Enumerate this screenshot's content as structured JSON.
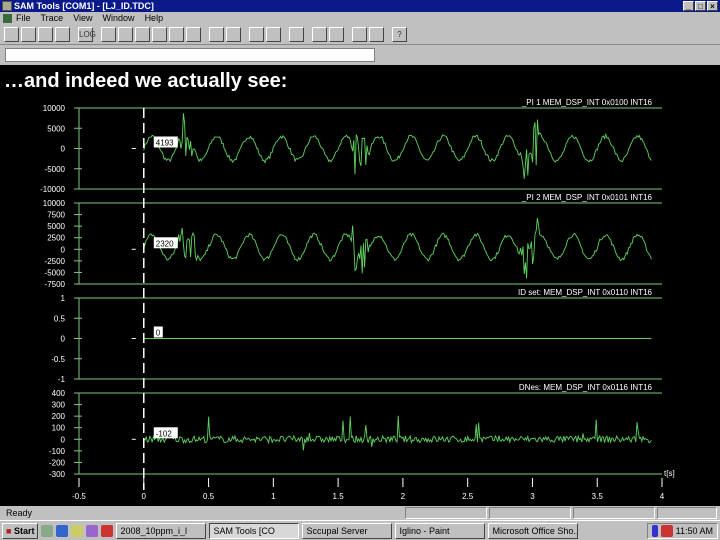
{
  "window": {
    "title": "SAM Tools [COM1] - [LJ_ID.TDC]",
    "controls": [
      "_",
      "□",
      "×"
    ]
  },
  "menu": [
    "File",
    "Trace",
    "View",
    "Window",
    "Help"
  ],
  "toolbar": {
    "icons": [
      "new-icon",
      "open-icon",
      "save-icon",
      "print-icon",
      "log-icon",
      "load-icon",
      "step-icon",
      "step2-icon",
      "run-icon",
      "stop-icon",
      "zoom-x-icon",
      "zoom-y-icon",
      "fit-icon",
      "grid-icon",
      "window-icon",
      "zoom-in-icon",
      "zoom-out-icon",
      "cascade-icon",
      "tile-h-icon",
      "tile-v-icon",
      "help-icon"
    ],
    "log_label": "LOG",
    "help_label": "?"
  },
  "command_input": {
    "value": ""
  },
  "heading": "…and indeed we actually see:",
  "chart_data": {
    "type": "line",
    "xlabel": "t[s]",
    "xlim": [
      -0.5,
      4
    ],
    "x_ticks": [
      "-0.5",
      "0",
      "0.5",
      "1",
      "1.5",
      "2",
      "2.5",
      "3",
      "3.5",
      "4"
    ],
    "cursor_x": 0,
    "panels": [
      {
        "title": "_PI 1 MEM_DSP_INT 0x0100 INT16",
        "ylim": [
          -10000,
          10000
        ],
        "y_ticks": [
          "10000",
          "5000",
          "0",
          "-5000",
          "-10000"
        ],
        "cursor_value": "4193"
      },
      {
        "title": "_PI 2 MEM_DSP_INT 0x0101 INT16",
        "ylim": [
          -7500,
          10000
        ],
        "y_ticks": [
          "10000",
          "7500",
          "5000",
          "2500",
          "0",
          "-2500",
          "-5000",
          "-7500"
        ],
        "cursor_value": "2320"
      },
      {
        "title": "ID set: MEM_DSP_INT 0x0110 INT16",
        "ylim": [
          -1,
          1
        ],
        "y_ticks": [
          "1",
          "0.5",
          "0",
          "-0.5",
          "-1"
        ],
        "cursor_value": "0"
      },
      {
        "title": "DNes: MEM_DSP_INT 0x0116 INT16",
        "ylim": [
          -300,
          400
        ],
        "y_ticks": [
          "400",
          "300",
          "200",
          "100",
          "0",
          "-100",
          "-200",
          "-300"
        ],
        "cursor_value": "-102"
      }
    ]
  },
  "status": "Ready",
  "taskbar": {
    "start": "Start",
    "tasks": [
      "2008_10ppm_i_l",
      "SAM Tools [CO",
      "Sccupal Server",
      "Iglino - Paint",
      "Microsoft Office Sho..."
    ],
    "active_index": 1,
    "clock": "11:50 AM"
  },
  "colors": {
    "trace": "#5fd35f",
    "axis": "#7fc77f",
    "titlebar": "#0a1a8a"
  }
}
